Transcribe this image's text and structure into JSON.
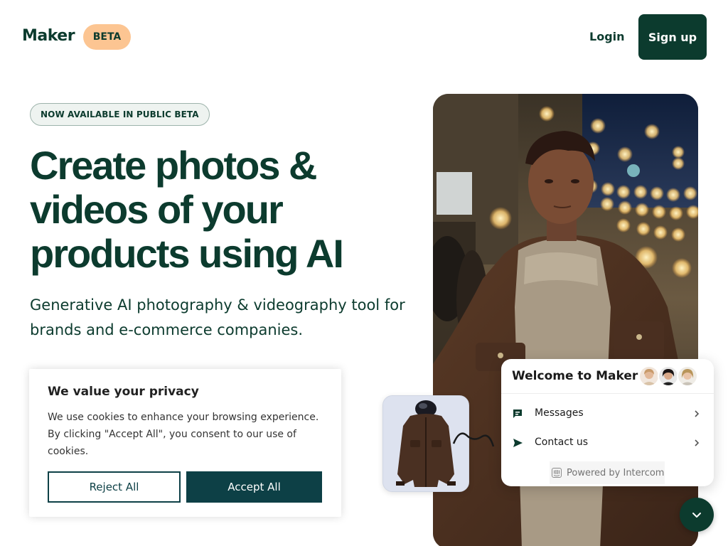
{
  "header": {
    "logo": "Maker",
    "badge": "BETA",
    "login_label": "Login",
    "signup_label": "Sign up"
  },
  "hero": {
    "pill": "NOW AVAILABLE IN PUBLIC BETA",
    "headline_line1": "Create photos &",
    "headline_line2": "videos of your",
    "headline_line3": "products using AI",
    "subhead": "Generative AI photography & videography tool for brands and e-commerce companies."
  },
  "cookie_banner": {
    "title": "We value your privacy",
    "text": "We use cookies to enhance your browsing experience. By clicking \"Accept All\", you consent to our use of cookies.",
    "reject_label": "Reject All",
    "accept_label": "Accept All"
  },
  "intercom": {
    "title": "Welcome to Maker",
    "rows": [
      {
        "label": "Messages",
        "icon": "chat-bubble-icon"
      },
      {
        "label": "Contact us",
        "icon": "send-icon"
      }
    ],
    "powered_by": "Powered by Intercom",
    "launcher_icon": "chevron-down-icon"
  },
  "colors": {
    "brand": "#0c3b2e",
    "badge": "#fcc592",
    "cookie_button": "#0d4046"
  }
}
